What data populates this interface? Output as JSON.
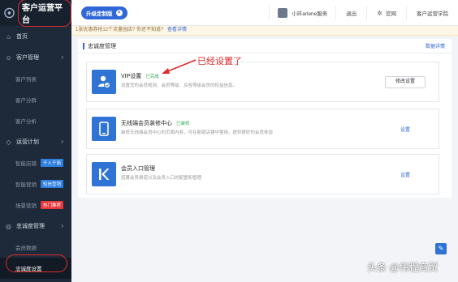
{
  "sidebar": {
    "logo_title": "客户运营平台",
    "items": [
      {
        "label": "首页",
        "icon": "home-icon"
      },
      {
        "label": "客户管理",
        "icon": "user-group-icon"
      },
      {
        "label": "客户列表"
      },
      {
        "label": "客户分群"
      },
      {
        "label": "客户分析"
      },
      {
        "label": "运营计划",
        "icon": "diamond-icon"
      },
      {
        "label": "智能店铺",
        "tag": "千人千面"
      },
      {
        "label": "智能营销",
        "tag": "短信营销"
      },
      {
        "label": "场景营销",
        "tag": "热门推荐"
      },
      {
        "label": "忠诚度管理",
        "icon": "badge-icon"
      },
      {
        "label": "会员数据"
      },
      {
        "label": "忠诚度设置"
      }
    ]
  },
  "topbar": {
    "upgrade_label": "升级定制版",
    "shop_name": "小环arlene服务",
    "logout": "退出",
    "official": "官网",
    "academy": "客户运营学院"
  },
  "notice": {
    "text": "1张优惠券抢12个流量园店? 你还不知道? ",
    "link": "查看详情"
  },
  "main": {
    "title": "忠诚度管理",
    "guide_link": "数据详情",
    "cards": [
      {
        "title": "VIP设置",
        "status": "已完成",
        "desc": "设置您的会员规则、会员等级、及各等级会员的权益信息。",
        "action": "修改设置"
      },
      {
        "title": "无线端会员装修中心",
        "status": "已装修",
        "desc": "装修无线端会员中心的页面内容，可在新版店铺中使用，提供更好的会员体验",
        "action": "设置"
      },
      {
        "title": "会员入口管理",
        "status": "",
        "desc": "招募会员渠道以及会员入口的配置和管理",
        "action": "设置"
      }
    ]
  },
  "annotation": "已经设置了",
  "watermark": "头条 @伟程商贸",
  "colors": {
    "accent": "#2f67d8",
    "sidebar": "#1e2a3a",
    "highlight": "#e02a2a",
    "success": "#35a853"
  }
}
